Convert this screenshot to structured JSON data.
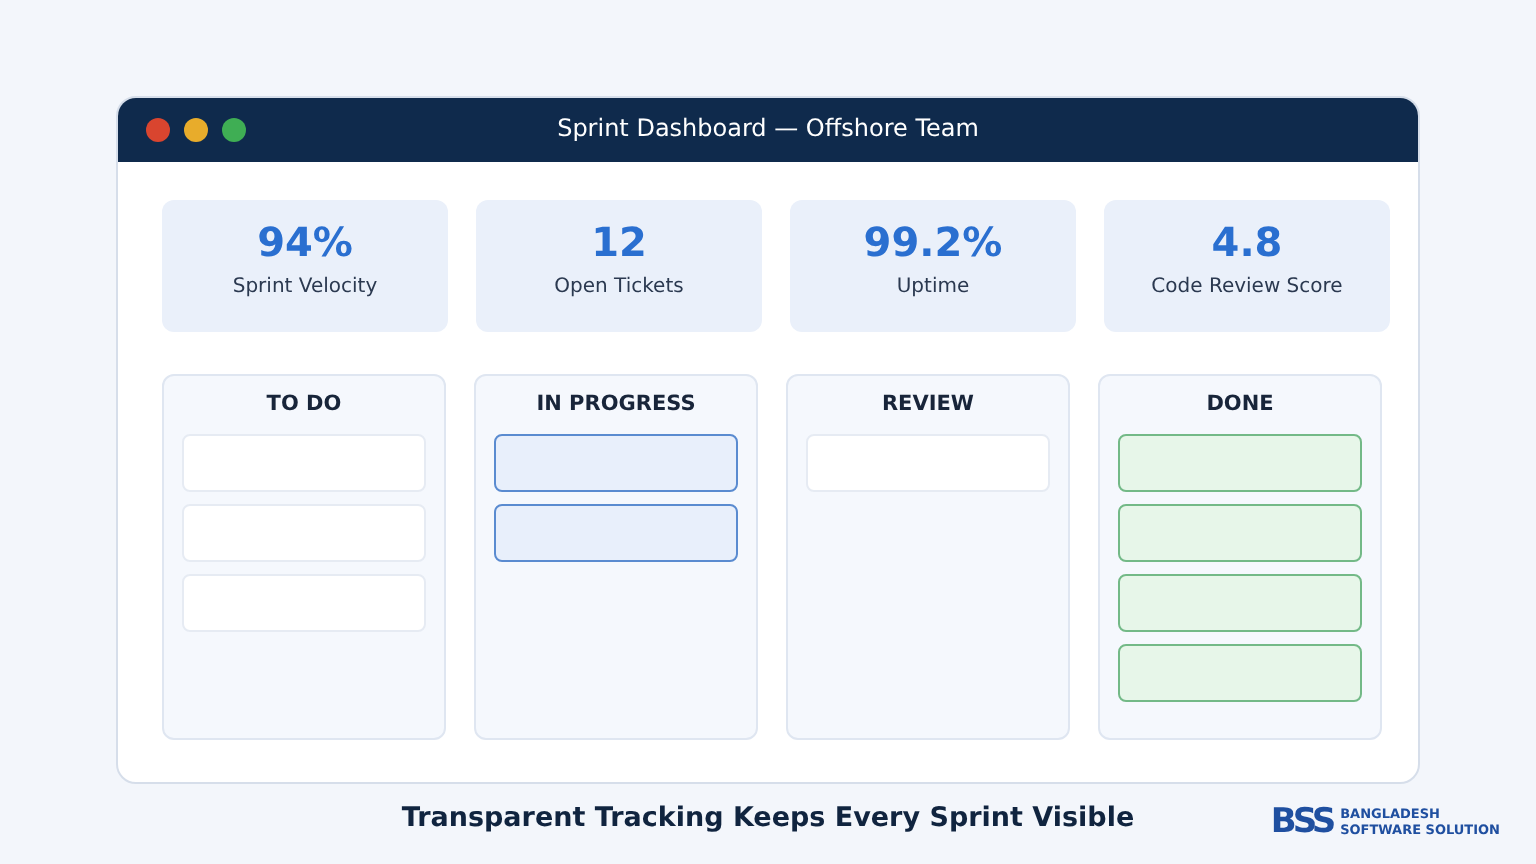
{
  "window": {
    "title": "Sprint Dashboard — Offshore Team"
  },
  "stats": [
    {
      "value": "94%",
      "label": "Sprint Velocity"
    },
    {
      "value": "12",
      "label": "Open Tickets"
    },
    {
      "value": "99.2%",
      "label": "Uptime"
    },
    {
      "value": "4.8",
      "label": "Code Review Score"
    }
  ],
  "columns": [
    {
      "title": "TO DO",
      "cards": [
        {
          "kind": "todo"
        },
        {
          "kind": "todo"
        },
        {
          "kind": "todo"
        }
      ]
    },
    {
      "title": "IN PROGRESS",
      "cards": [
        {
          "kind": "progress"
        },
        {
          "kind": "progress"
        }
      ]
    },
    {
      "title": "REVIEW",
      "cards": [
        {
          "kind": "todo"
        }
      ]
    },
    {
      "title": "DONE",
      "cards": [
        {
          "kind": "done"
        },
        {
          "kind": "done"
        },
        {
          "kind": "done"
        },
        {
          "kind": "done"
        }
      ]
    }
  ],
  "caption": "Transparent Tracking Keeps Every Sprint Visible",
  "logo": {
    "mark": "BSS",
    "line_1": "BANGLADESH",
    "line_2": "SOFTWARE SOLUTION"
  }
}
